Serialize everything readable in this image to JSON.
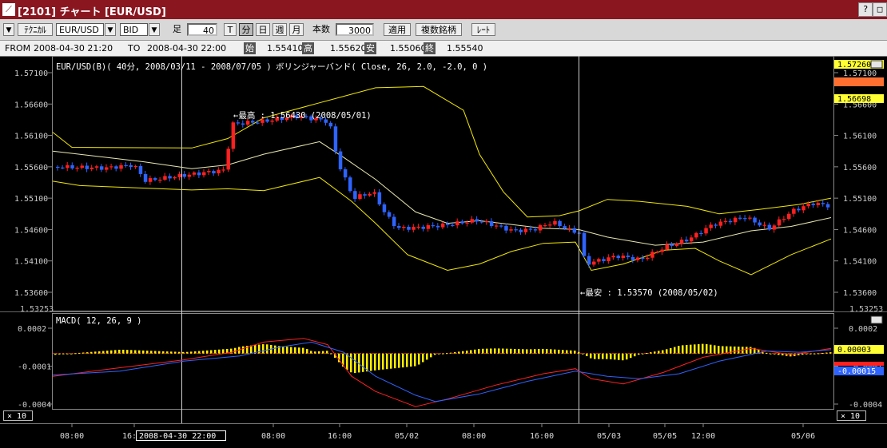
{
  "window": {
    "title": "[2101] チャート [EUR/USD]",
    "buttons": [
      "?",
      "□"
    ]
  },
  "toolbar": {
    "menu_glyph": "▼",
    "technical_label": "ﾃｸﾆｶﾙ",
    "symbol": "EUR/USD",
    "price_type": "BID",
    "ashi_label": "足",
    "ashi_value": "40",
    "period_buttons": [
      {
        "label": "T",
        "active": false
      },
      {
        "label": "分",
        "active": true
      },
      {
        "label": "日",
        "active": false
      },
      {
        "label": "週",
        "active": false
      },
      {
        "label": "月",
        "active": false
      }
    ],
    "count_label": "本数",
    "count_value": "3000",
    "apply_label": "適用",
    "multi_label": "複数銘柄",
    "rate_label": "ﾚｰﾄ"
  },
  "infobar": {
    "from_label": "FROM",
    "from_value": "2008-04-30  21:20",
    "to_label": "TO",
    "to_value": "2008-04-30  22:00",
    "open_label": "始",
    "open_value": "1.55410",
    "high_label": "高",
    "high_value": "1.55620",
    "low_label": "安",
    "low_value": "1.55060",
    "close_label": "終",
    "close_value": "1.55540"
  },
  "main_chart": {
    "header": "EUR/USD(B)( 40分, 2008/03/11 - 2008/07/05 )",
    "indicator": "ボリンジャーバンド( Close, 26, 2.0, -2.0, 0 )",
    "high_note": "←最高 : 1.56430 (2008/05/01)",
    "low_note": "←最安 : 1.53570 (2008/05/02)",
    "y_ticks": [
      "1.57100",
      "1.56600",
      "1.56100",
      "1.55600",
      "1.55100",
      "1.54600",
      "1.54100",
      "1.53600"
    ],
    "cut_tick": "1.53253",
    "right_badges": {
      "top": "1.57260",
      "mid": "1.56698"
    },
    "colors": {
      "up": "#ff2020",
      "down": "#2e63ff",
      "band": "#f2e800",
      "mid": "#e8e8b0",
      "crosshair": "#cfcfcf"
    }
  },
  "macd_chart": {
    "header": "MACD( 12, 26, 9 )",
    "y_ticks": [
      "0.0002",
      "-0.0001",
      "-0.0004"
    ],
    "badges": {
      "hist": "0.00003",
      "red": "-0.0001",
      "blue": "-0.00015"
    },
    "colors": {
      "macd": "#ff2020",
      "signal": "#2e63ff",
      "hist": "#ffee00"
    }
  },
  "zoom_left": "× 10",
  "zoom_right": "× 10",
  "x_axis": {
    "ticks": [
      "08:00",
      "16:00",
      "08:00",
      "16:00",
      "05/02",
      "08:00",
      "16:00",
      "05/03",
      "05/05",
      "12:00",
      "05/06"
    ],
    "cursor_label": "2008-04-30  22:00"
  }
}
